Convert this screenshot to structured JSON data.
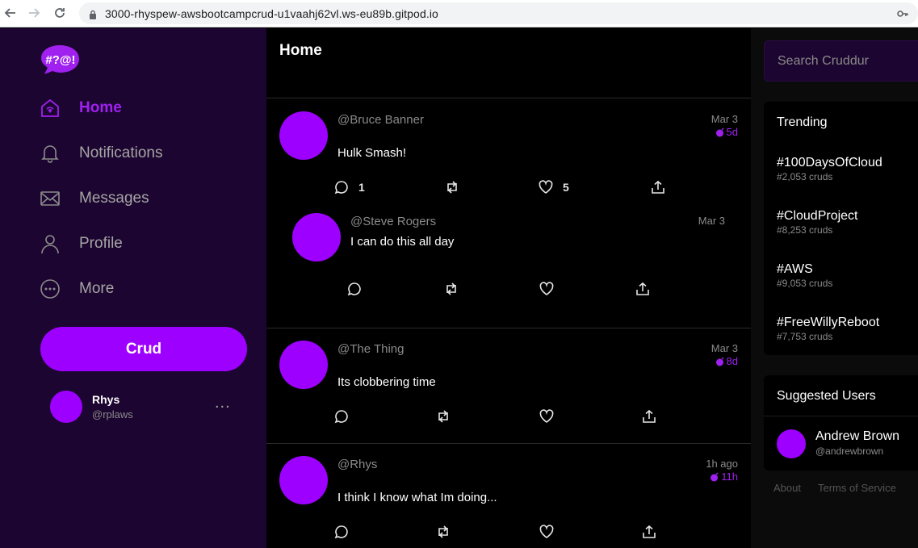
{
  "browser": {
    "url": "3000-rhyspew-awsbootcampcrud-u1vaahj62vl.ws-eu89b.gitpod.io"
  },
  "colors": {
    "accent": "#9d00ff",
    "sidebar_bg": "#1c0530",
    "feed_bg": "#000000"
  },
  "logo": {
    "text": "#?@!"
  },
  "nav": {
    "items": [
      {
        "label": "Home",
        "icon": "home-icon"
      },
      {
        "label": "Notifications",
        "icon": "bell-icon"
      },
      {
        "label": "Messages",
        "icon": "envelope-icon"
      },
      {
        "label": "Profile",
        "icon": "person-icon"
      },
      {
        "label": "More",
        "icon": "more-circle-icon"
      }
    ],
    "crud_button": "Crud"
  },
  "user": {
    "name": "Rhys",
    "handle": "@rplaws",
    "menu": "..."
  },
  "feed": {
    "title": "Home",
    "posts": [
      {
        "handle": "@Bruce Banner",
        "message": "Hulk Smash!",
        "date": "Mar 3",
        "expires": "5d",
        "replies": "1",
        "likes": "5"
      },
      {
        "handle": "@Steve Rogers",
        "message": "I can do this all day",
        "date": "Mar 3"
      },
      {
        "handle": "@The Thing",
        "message": "Its clobbering time",
        "date": "Mar 3",
        "expires": "8d"
      },
      {
        "handle": "@Rhys",
        "message": "I think I know what Im doing...",
        "date": "1h ago",
        "expires": "11h"
      }
    ]
  },
  "search": {
    "placeholder": "Search Cruddur"
  },
  "trending": {
    "title": "Trending",
    "items": [
      {
        "tag": "#100DaysOfCloud",
        "count": "#2,053 cruds"
      },
      {
        "tag": "#CloudProject",
        "count": "#8,253 cruds"
      },
      {
        "tag": "#AWS",
        "count": "#9,053 cruds"
      },
      {
        "tag": "#FreeWillyReboot",
        "count": "#7,753 cruds"
      }
    ]
  },
  "suggested": {
    "title": "Suggested Users",
    "users": [
      {
        "name": "Andrew Brown",
        "handle": "@andrewbrown"
      }
    ]
  },
  "footer": {
    "about": "About",
    "terms": "Terms of Service"
  }
}
